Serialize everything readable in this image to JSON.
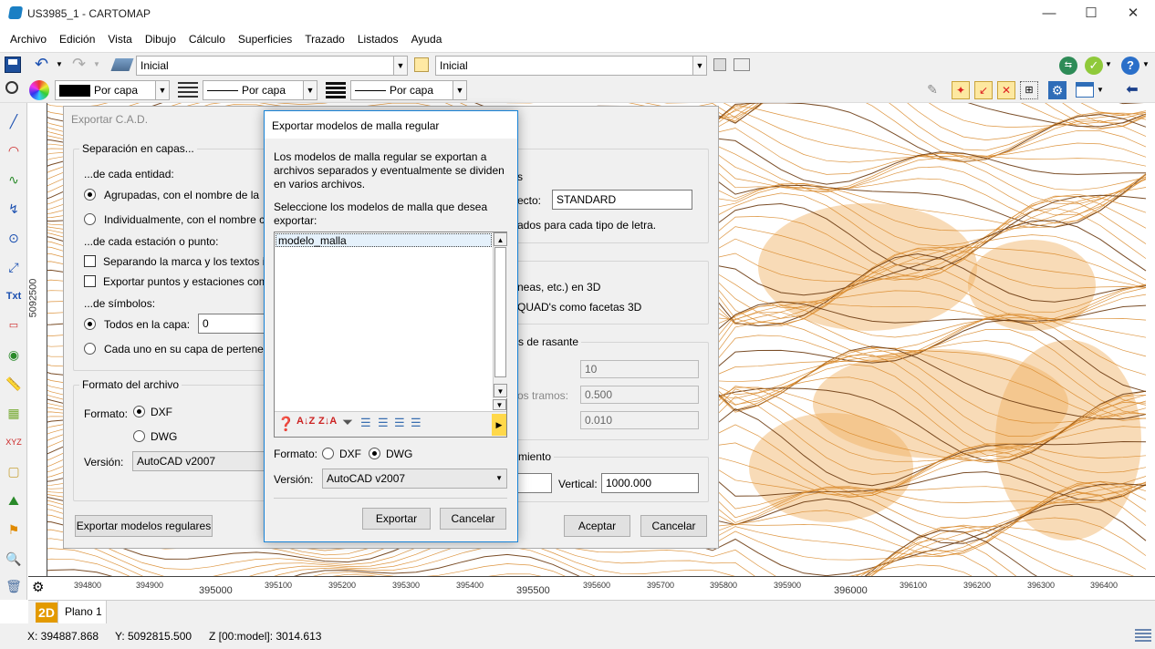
{
  "window": {
    "title": "US3985_1 - CARTOMAP",
    "min": "—",
    "max": "☐",
    "close": "✕"
  },
  "menubar": [
    "Archivo",
    "Edición",
    "Vista",
    "Dibujo",
    "Cálculo",
    "Superficies",
    "Trazado",
    "Listados",
    "Ayuda"
  ],
  "toolbar": {
    "layer_combo": "Inicial",
    "style_combo": "Inicial",
    "color_combo": "Por capa",
    "linetype_combo": "Por capa",
    "lineweight_combo": "Por capa"
  },
  "map": {
    "x_ticks_small": [
      "394800",
      "394900",
      "395100",
      "395200",
      "395300",
      "395400",
      "395600",
      "395700",
      "395800",
      "395900",
      "396100",
      "396200",
      "396300",
      "396400"
    ],
    "x_ticks_big": [
      "395000",
      "395500",
      "396000"
    ],
    "y_label": "5092500"
  },
  "tab": {
    "mode": "2D",
    "name": "Plano 1"
  },
  "status": {
    "x": "X:  394887.868",
    "y": "Y:  5092815.500",
    "z": "Z [00:model]:  3014.613"
  },
  "back_dialog": {
    "title": "Exportar C.A.D.",
    "g1_label": "Separación en capas...",
    "entidad": "...de cada entidad:",
    "agrupadas": "Agrupadas, con el nombre de la",
    "individual": "Individualmente, con el nombre c",
    "estacion": "...de cada estación o punto:",
    "separando": "Separando la marca y los textos ir",
    "exportar_puntos": "Exportar puntos y estaciones com",
    "simbolos": "...de símbolos:",
    "todos": "Todos en la capa:",
    "todos_value": "0",
    "cada_uno": "Cada uno en su capa de pertenen",
    "formato_label": "Formato del archivo",
    "formato": "Formato:",
    "dxf": "DXF",
    "dwg": "DWG",
    "version": "Versión:",
    "version_value": "AutoCAD v2007",
    "export_regular": "Exportar modelos regulares",
    "r_s": "s",
    "r_ecto": "ecto:",
    "r_ecto_value": "STANDARD",
    "r_ados": "ados para cada tipo de letra.",
    "r_neas": "neas, etc.) en 3D",
    "r_quad": "QUAD's como facetas 3D",
    "r_rasante": "s de rasante",
    "r_val1": "10",
    "r_tramos": "os tramos:",
    "r_val2": "0.500",
    "r_val3": "0.010",
    "r_miento": "miento",
    "r_vertical": "Vertical:",
    "r_vertical_value": "1000.000",
    "accept": "Aceptar",
    "cancel": "Cancelar"
  },
  "front_dialog": {
    "title": "Exportar modelos de malla regular",
    "desc": "Los modelos de malla regular se exportan a archivos separados y eventualmente se dividen en varios archivos.",
    "select": "Seleccione los modelos de malla que desea exportar:",
    "items": [
      "modelo_malla"
    ],
    "formato": "Formato:",
    "dxf": "DXF",
    "dwg": "DWG",
    "version": "Versión:",
    "version_value": "AutoCAD v2007",
    "export": "Exportar",
    "cancel": "Cancelar"
  }
}
